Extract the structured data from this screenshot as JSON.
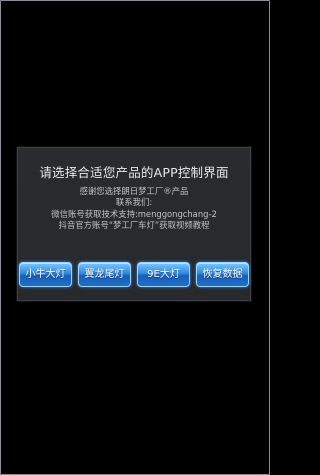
{
  "dialog": {
    "title": "请选择合适您产品的APP控制界面",
    "message_lines": [
      "感谢您选择朗日梦工厂®产品",
      "联系我们:",
      "微信账号获取技术支持:menggongchang-2",
      "抖音官方账号“梦工厂车灯”获取视频教程"
    ],
    "buttons": [
      {
        "label": "小牛大灯"
      },
      {
        "label": "翼龙尾灯"
      },
      {
        "label": "9E大灯"
      },
      {
        "label": "恢复数据"
      }
    ]
  },
  "colors": {
    "background": "#000000",
    "dialog_bg": "#292a2d",
    "button_blue": "#2e8be0"
  }
}
